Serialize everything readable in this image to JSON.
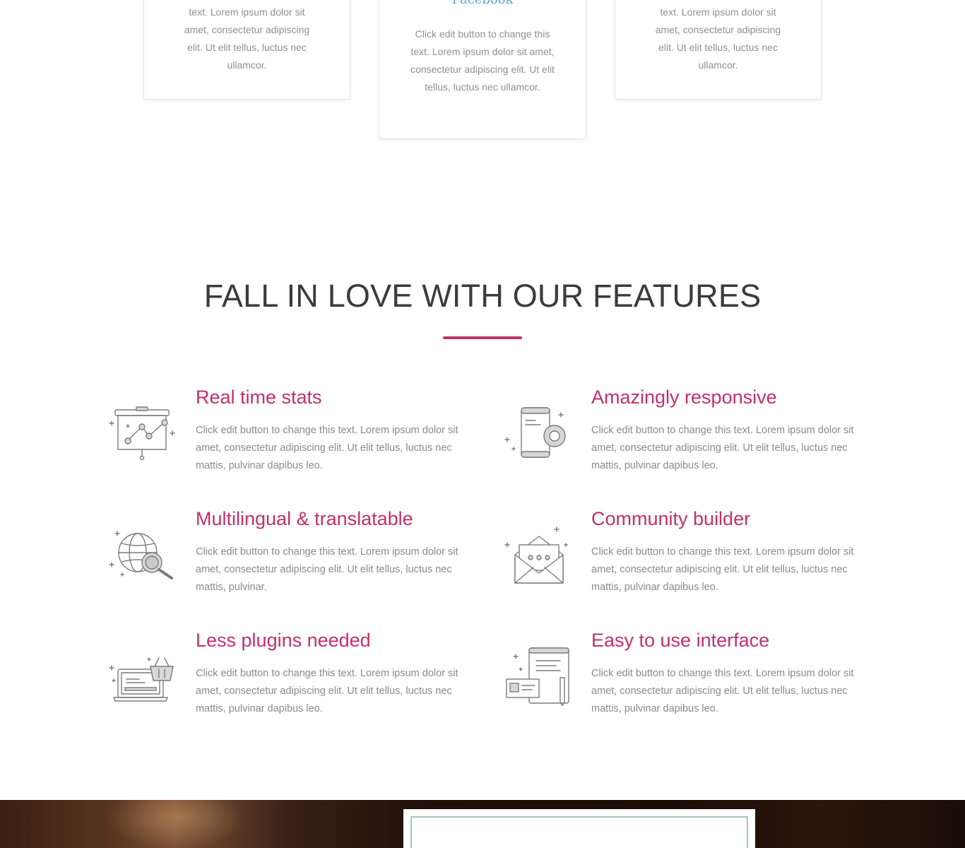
{
  "testimonials": [
    {
      "text": "text. Lorem ipsum dolor sit amet, consectetur adipiscing elit. Ut elit tellus, luctus nec ullamcor."
    },
    {
      "title": "Facebook",
      "text": "Click edit button to change this text. Lorem ipsum dolor sit amet, consectetur adipiscing elit. Ut elit tellus, luctus nec ullamcor."
    },
    {
      "text": "text. Lorem ipsum dolor sit amet, consectetur adipiscing elit. Ut elit tellus, luctus nec ullamcor."
    }
  ],
  "features_section": {
    "title": "FALL IN LOVE WITH OUR FEATURES",
    "accent_color": "#c2306b",
    "items": [
      {
        "icon": "presentation-chart-icon",
        "title": "Real time stats",
        "desc": "Click edit button to change this text. Lorem ipsum dolor sit amet, consectetur adipiscing elit. Ut elit tellus, luctus nec mattis, pulvinar dapibus leo."
      },
      {
        "icon": "mobile-gear-icon",
        "title": "Amazingly responsive",
        "desc": "Click edit button to change this text. Lorem ipsum dolor sit amet, consectetur adipiscing elit. Ut elit tellus, luctus nec mattis, pulvinar dapibus leo."
      },
      {
        "icon": "globe-search-icon",
        "title": "Multilingual & translatable",
        "desc": "Click edit button to change this text. Lorem ipsum dolor sit amet, consectetur adipiscing elit. Ut elit tellus, luctus nec mattis, pulvinar."
      },
      {
        "icon": "envelope-chat-icon",
        "title": "Community builder",
        "desc": "Click edit button to change this text. Lorem ipsum dolor sit amet, consectetur adipiscing elit. Ut elit tellus, luctus nec mattis, pulvinar dapibus leo."
      },
      {
        "icon": "laptop-basket-icon",
        "title": "Less plugins needed",
        "desc": "Click edit button to change this text. Lorem ipsum dolor sit amet, consectetur adipiscing elit. Ut elit tellus, luctus nec mattis, pulvinar dapibus leo."
      },
      {
        "icon": "document-card-pen-icon",
        "title": "Easy to use interface",
        "desc": "Click edit button to change this text. Lorem ipsum dolor sit amet, consectetur adipiscing elit. Ut elit tellus, luctus nec mattis, pulvinar dapibus leo."
      }
    ]
  }
}
